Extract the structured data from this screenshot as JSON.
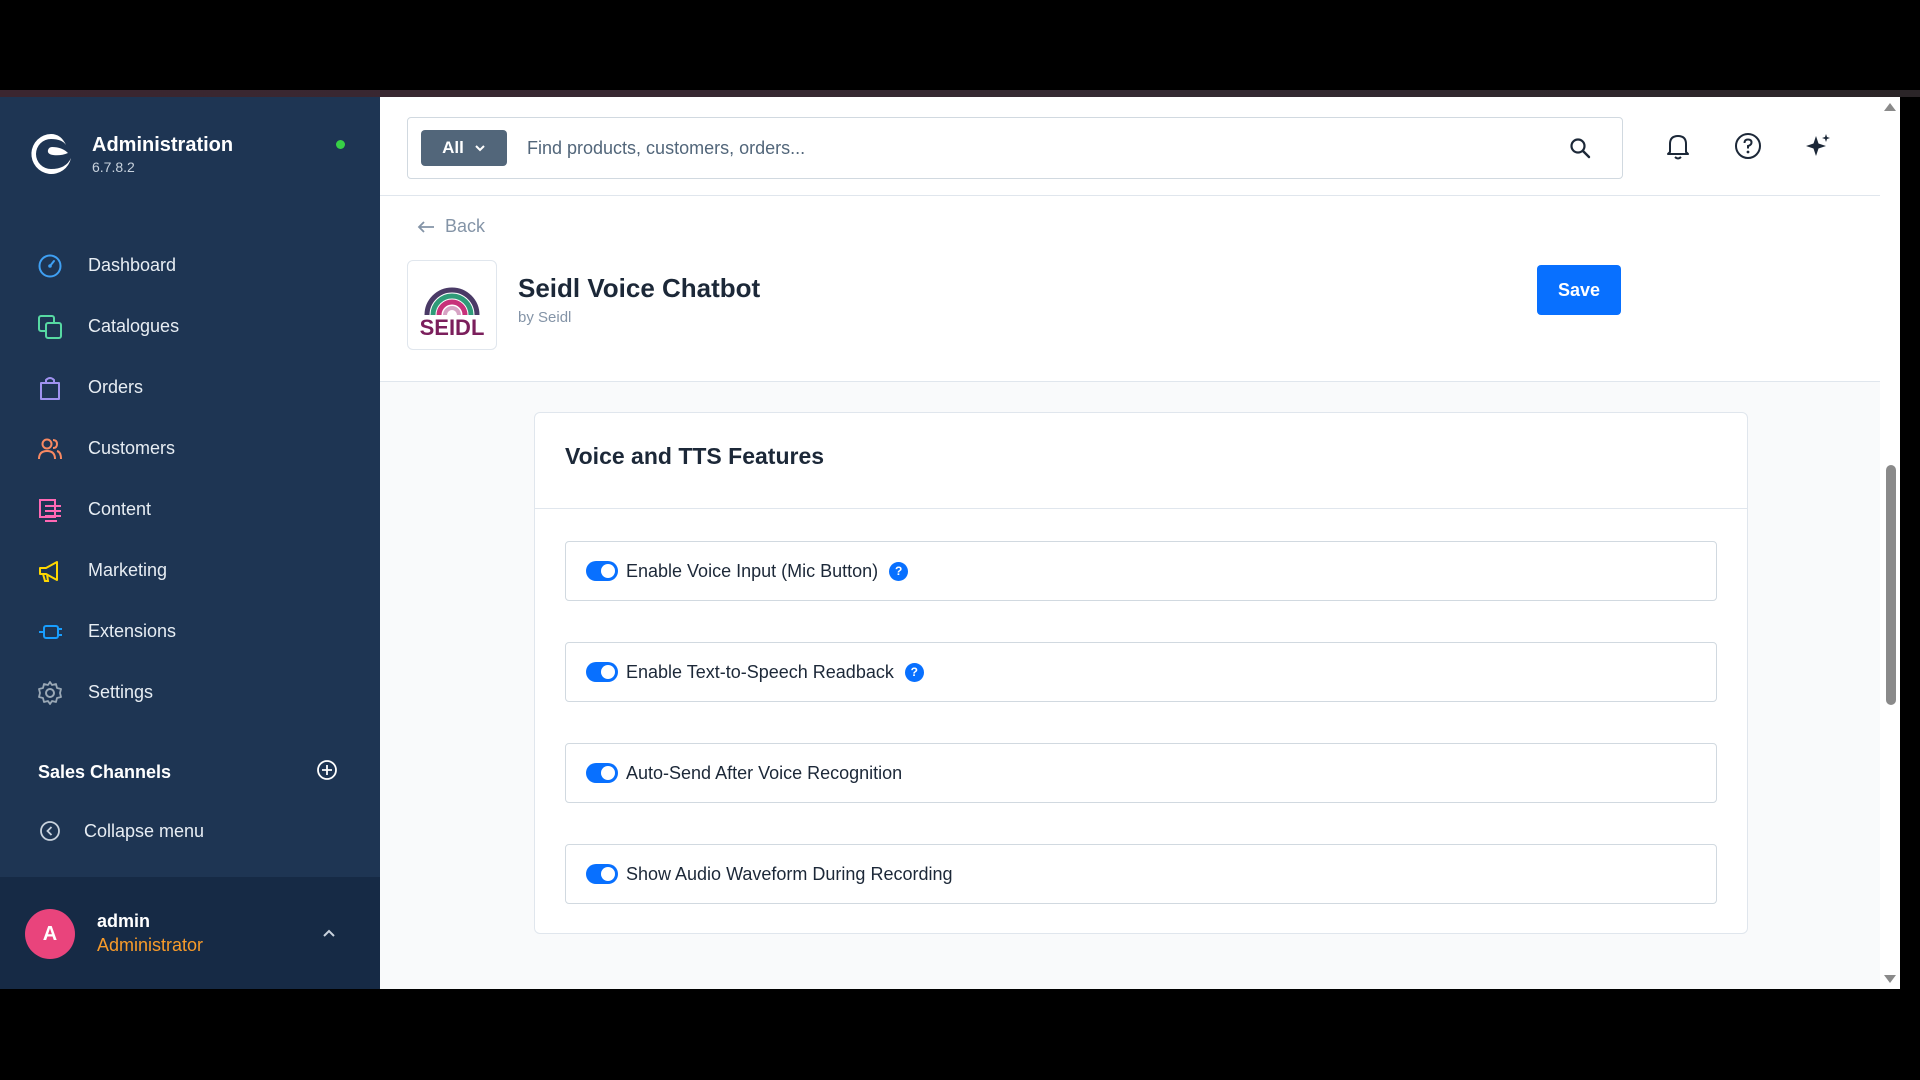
{
  "sidebar": {
    "brand_title": "Administration",
    "brand_version": "6.7.8.2",
    "status_color": "#37d046",
    "nav_items": [
      {
        "label": "Dashboard",
        "icon": "gauge-icon",
        "color": "#3fa0f3"
      },
      {
        "label": "Catalogues",
        "icon": "catalogue-icon",
        "color": "#57d9a3"
      },
      {
        "label": "Orders",
        "icon": "shopping-bag-icon",
        "color": "#a092f0"
      },
      {
        "label": "Customers",
        "icon": "users-icon",
        "color": "#f88962"
      },
      {
        "label": "Content",
        "icon": "content-icon",
        "color": "#ff68b4"
      },
      {
        "label": "Marketing",
        "icon": "megaphone-icon",
        "color": "#ffd700"
      },
      {
        "label": "Extensions",
        "icon": "plug-icon",
        "color": "#189eff"
      },
      {
        "label": "Settings",
        "icon": "gear-icon",
        "color": "#9aa8b5"
      }
    ],
    "sales_channels_label": "Sales Channels",
    "collapse_label": "Collapse menu",
    "user": {
      "initial": "A",
      "name": "admin",
      "role": "Administrator"
    }
  },
  "header": {
    "search_type": "All",
    "search_placeholder": "Find products, customers, orders..."
  },
  "smart_bar": {
    "back_label": "Back",
    "plugin_name": "Seidl Voice Chatbot",
    "plugin_author": "by Seidl",
    "logo_text": "SEIDL",
    "save_label": "Save"
  },
  "card": {
    "title": "Voice and TTS Features",
    "fields": [
      {
        "label": "Enable Voice Input (Mic Button)",
        "enabled": true,
        "help": true
      },
      {
        "label": "Enable Text-to-Speech Readback",
        "enabled": true,
        "help": true
      },
      {
        "label": "Auto-Send After Voice Recognition",
        "enabled": true,
        "help": false
      },
      {
        "label": "Show Audio Waveform During Recording",
        "enabled": true,
        "help": false
      }
    ]
  },
  "colors": {
    "sidebar_bg": "#1e3553",
    "primary": "#0870ff",
    "role_color": "#f89b2a",
    "avatar_bg": "#e9447c"
  }
}
